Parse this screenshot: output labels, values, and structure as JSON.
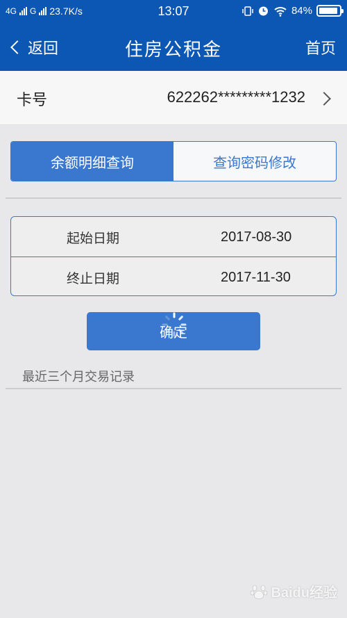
{
  "status_bar": {
    "network_1": "4G",
    "network_2": "G",
    "speed": "23.7K/s",
    "time": "13:07",
    "battery": "84%",
    "icons": [
      "vibrate-icon",
      "alarm-icon",
      "wifi-icon",
      "battery-icon"
    ]
  },
  "nav": {
    "back_label": "返回",
    "title": "住房公积金",
    "home_label": "首页"
  },
  "card": {
    "label": "卡号",
    "number": "622262*********1232"
  },
  "tabs": [
    {
      "label": "余额明细查询",
      "active": true
    },
    {
      "label": "查询密码修改",
      "active": false
    }
  ],
  "dates": {
    "start_label": "起始日期",
    "start_value": "2017-08-30",
    "end_label": "终止日期",
    "end_value": "2017-11-30"
  },
  "confirm_label": "确定",
  "recent_label": "最近三个月交易记录",
  "watermark": "Baidu经验",
  "colors": {
    "primary": "#0d57b4",
    "accent": "#3a78cf",
    "background": "#e8e8ea"
  }
}
